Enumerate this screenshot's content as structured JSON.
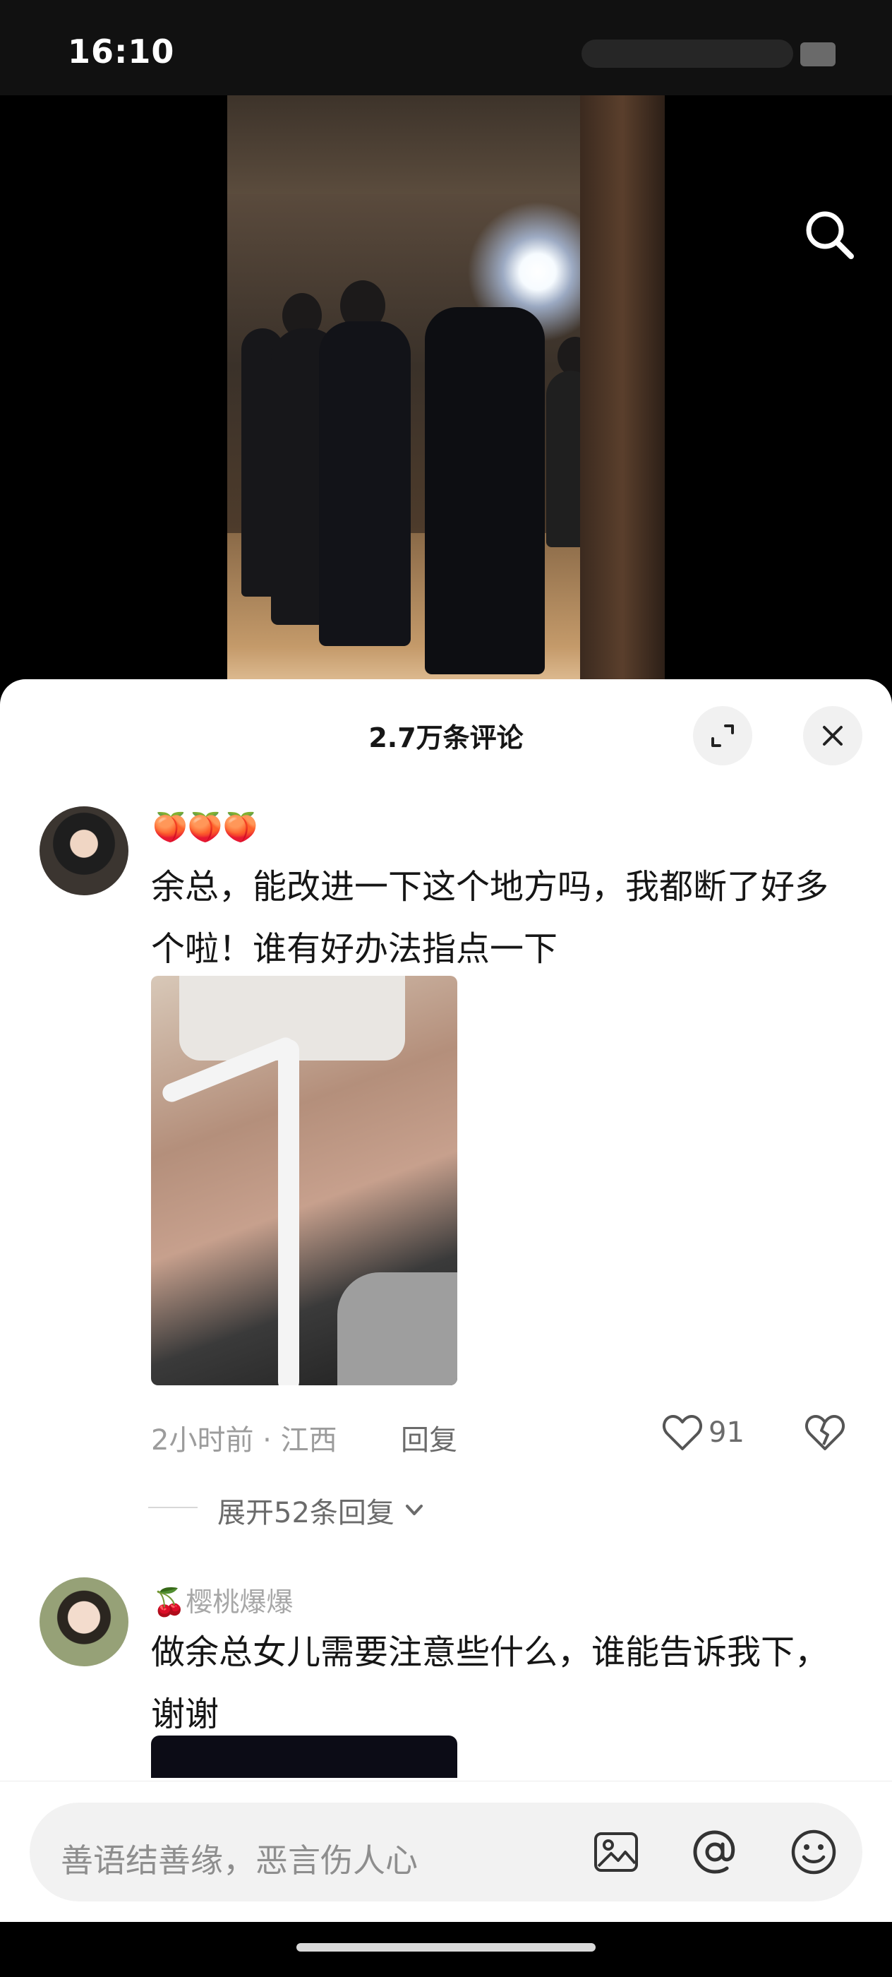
{
  "status_bar": {
    "time": "16:10"
  },
  "video": {
    "search_icon": "search-icon"
  },
  "comments_sheet": {
    "title": "2.7万条评论",
    "expand_icon": "expand-icon",
    "close_icon": "close-icon",
    "comments": [
      {
        "name_emoji": "🍑🍑🍑",
        "text": "余总，能改进一下这个地方吗，我都断了好多个啦！谁有好办法指点一下",
        "time": "2小时前 · 江西",
        "reply_label": "回复",
        "likes": "91",
        "expand_replies": "展开52条回复"
      },
      {
        "name": "🍒樱桃爆爆",
        "text": "做余总女儿需要注意些什么，谁能告诉我下，谢谢"
      }
    ]
  },
  "input_bar": {
    "placeholder": "善语结善缘，恶言伤人心",
    "icons": [
      "image-icon",
      "at-icon",
      "emoji-icon"
    ]
  },
  "colors": {
    "sheet": "#ffffff",
    "text": "#161616",
    "muted": "#9c9c9c"
  }
}
